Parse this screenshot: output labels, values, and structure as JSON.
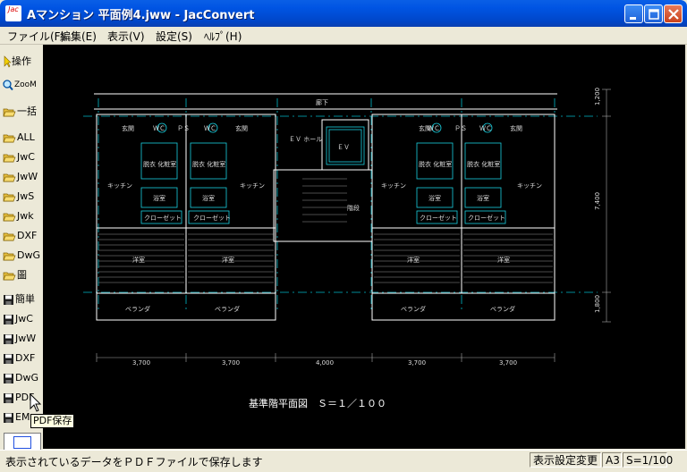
{
  "window": {
    "title": "Aマンション 平面例4.jww - JacConvert",
    "icon_text": "Jac",
    "buttons": [
      "minimize-icon",
      "maximize-icon",
      "close-icon"
    ]
  },
  "menu": {
    "items": [
      "ファイル(F)",
      "編集(E)",
      "表示(V)",
      "設定(S)",
      "ﾍﾙﾌﾟ(H)"
    ]
  },
  "toolbar": {
    "items": [
      {
        "icon": "pointer-icon",
        "label": "操作"
      },
      {
        "icon": "zoom-icon",
        "label": "ZooM"
      },
      {
        "icon": "folder-open-icon",
        "label": "一括"
      },
      {
        "icon": "folder-open-icon",
        "label": "ALL"
      },
      {
        "icon": "folder-open-icon",
        "label": "JwC"
      },
      {
        "icon": "folder-open-icon",
        "label": "JwW"
      },
      {
        "icon": "folder-open-icon",
        "label": "JwS"
      },
      {
        "icon": "folder-open-icon",
        "label": "Jwk"
      },
      {
        "icon": "folder-open-icon",
        "label": "DXF"
      },
      {
        "icon": "folder-open-icon",
        "label": "DwG"
      },
      {
        "icon": "folder-open-icon",
        "label": "圖"
      },
      {
        "icon": "save-icon",
        "label": "簡単"
      },
      {
        "icon": "save-icon",
        "label": "JwC"
      },
      {
        "icon": "save-icon",
        "label": "JwW"
      },
      {
        "icon": "save-icon",
        "label": "DXF"
      },
      {
        "icon": "save-icon",
        "label": "DwG"
      },
      {
        "icon": "save-icon",
        "label": "PDF"
      },
      {
        "icon": "save-icon",
        "label": "EM"
      }
    ]
  },
  "tooltip": "PDF保存",
  "drawing": {
    "caption": "基準階平面図　Ｓ＝１／１００",
    "labels": {
      "corridor": "廊下",
      "ev": "ＥＶ",
      "ev_hall": "ＥＶ\nホール",
      "stairs": "階段",
      "entrance": "玄関",
      "changing": "脱衣\n化粧室",
      "kitchen": "キッチン",
      "bath": "浴室",
      "closet": "クローゼット",
      "western_room": "洋室",
      "veranda": "ベランダ",
      "ps": "ＰＳ",
      "wc": "ＷＣ"
    },
    "dimensions": [
      "3,700",
      "3,700",
      "4,000",
      "3,700",
      "3,700"
    ],
    "right_dimensions": [
      "1,200",
      "7,400",
      "1,800"
    ]
  },
  "status": {
    "message": "表示されているデータをＰＤＦファイルで保存します",
    "display_setting": "表示設定変更",
    "paper": "A3",
    "scale": "S=1/100"
  }
}
